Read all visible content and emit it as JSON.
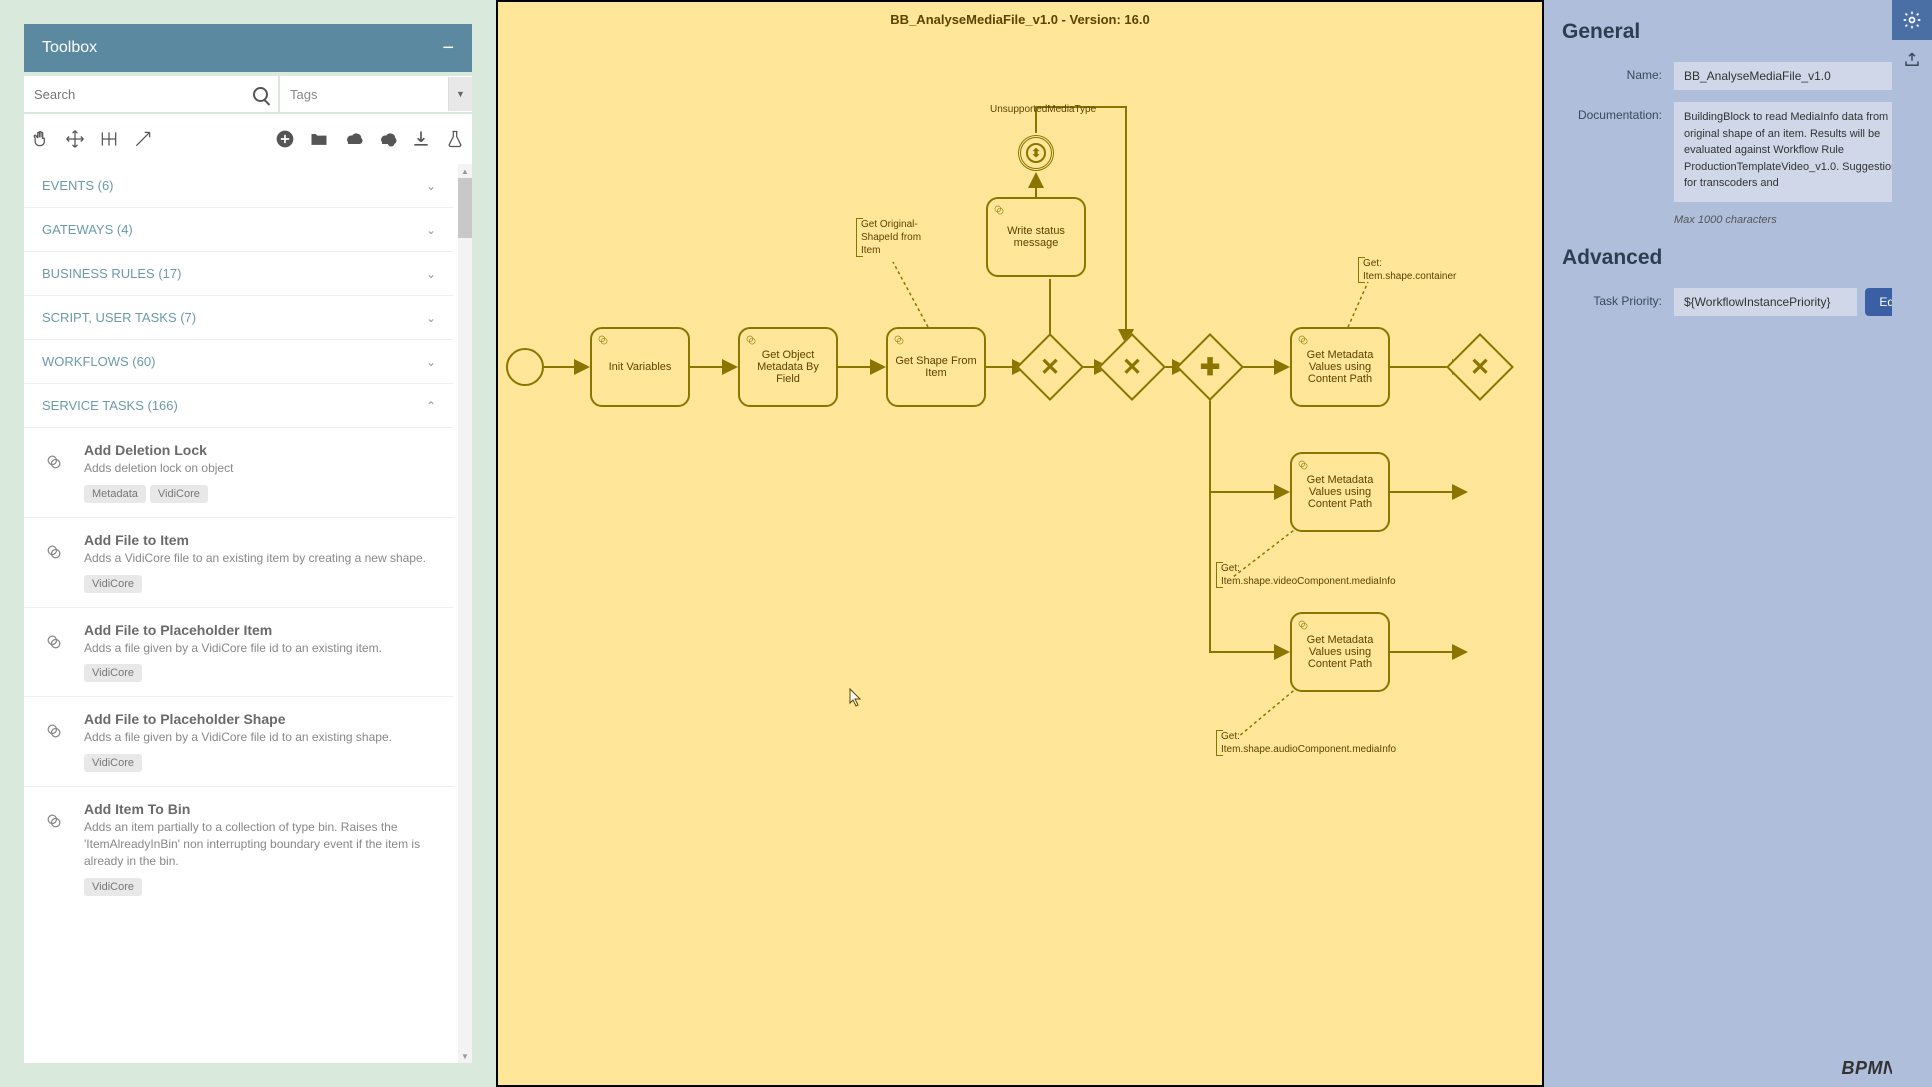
{
  "toolbox": {
    "title": "Toolbox",
    "search_placeholder": "Search",
    "tags_label": "Tags"
  },
  "categories": [
    {
      "label": "EVENTS (6)",
      "expanded": false
    },
    {
      "label": "GATEWAYS (4)",
      "expanded": false
    },
    {
      "label": "BUSINESS RULES (17)",
      "expanded": false
    },
    {
      "label": "SCRIPT, USER TASKS (7)",
      "expanded": false
    },
    {
      "label": "WORKFLOWS (60)",
      "expanded": false
    },
    {
      "label": "SERVICE TASKS (166)",
      "expanded": true
    }
  ],
  "service_tasks": [
    {
      "title": "Add Deletion Lock",
      "desc": "Adds deletion lock on object",
      "tags": [
        "Metadata",
        "VidiCore"
      ]
    },
    {
      "title": "Add File to Item",
      "desc": "Adds a VidiCore file to an existing item by creating a new shape.",
      "tags": [
        "VidiCore"
      ]
    },
    {
      "title": "Add File to Placeholder Item",
      "desc": "Adds a file given by a VidiCore file id to an existing item.",
      "tags": [
        "VidiCore"
      ]
    },
    {
      "title": "Add File to Placeholder Shape",
      "desc": "Adds a file given by a VidiCore file id to an existing shape.",
      "tags": [
        "VidiCore"
      ]
    },
    {
      "title": "Add Item To Bin",
      "desc": "Adds an item partially to a collection of type bin. Raises the 'ItemAlreadyInBin' non interrupting boundary event if the item is already in the bin.",
      "tags": [
        "VidiCore"
      ]
    }
  ],
  "diagram": {
    "title": "BB_AnalyseMediaFile_v1.0 - Version: 16.0",
    "event_label": "UnsupportedMediaType",
    "tasks": {
      "init": "Init Variables",
      "getObject": "Get Object Metadata By Field",
      "getShape": "Get Shape From Item",
      "writeStatus": "Write status message",
      "getMeta1": "Get Metadata Values using Content Path",
      "getMeta2": "Get Metadata Values using Content Path",
      "getMeta3": "Get Metadata Values using Content Path"
    },
    "annotations": {
      "a1": "Get Original-ShapeId from Item",
      "a2": "Get:\nItem.shape.container",
      "a3": "Get:\nItem.shape.videoComponent.mediaInfo",
      "a4": "Get:\nItem.shape.audioComponent.mediaInfo"
    }
  },
  "properties": {
    "general_heading": "General",
    "advanced_heading": "Advanced",
    "name_label": "Name:",
    "name_value": "BB_AnalyseMediaFile_v1.0",
    "doc_label": "Documentation:",
    "doc_value": "BuildingBlock to read MediaInfo data from original shape of an item. Results will be evaluated against Workflow Rule ProductionTemplateVideo_v1.0. Suggestions for transcoders and",
    "max_chars": "Max 1000 characters",
    "priority_label": "Task Priority:",
    "priority_value": "${WorkflowInstancePriority}",
    "edit_label": "Edit"
  },
  "footer": {
    "logo": "BPMN.iO"
  }
}
